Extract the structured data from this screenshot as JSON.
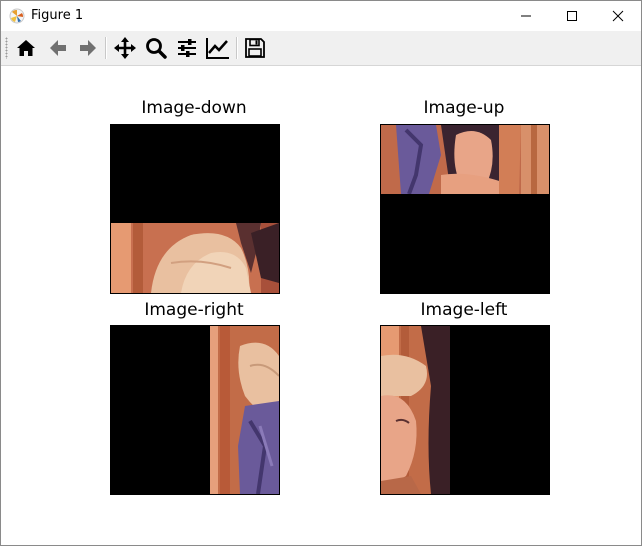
{
  "window": {
    "title": "Figure 1",
    "controls": [
      "minimize",
      "maximize",
      "close"
    ]
  },
  "toolbar": {
    "buttons": [
      {
        "icon": "home-icon",
        "tooltip": "Home"
      },
      {
        "icon": "back-arrow-icon",
        "tooltip": "Back"
      },
      {
        "icon": "forward-arrow-icon",
        "tooltip": "Forward"
      },
      {
        "icon": "pan-move-icon",
        "tooltip": "Pan"
      },
      {
        "icon": "zoom-magnifier-icon",
        "tooltip": "Zoom"
      },
      {
        "icon": "configure-subplots-icon",
        "tooltip": "Subplots"
      },
      {
        "icon": "edit-axis-icon",
        "tooltip": "Customize"
      },
      {
        "icon": "save-floppy-icon",
        "tooltip": "Save"
      }
    ]
  },
  "figure": {
    "subplots": [
      {
        "title": "Image-down",
        "shift": "down",
        "image_fraction_visible": 0.42
      },
      {
        "title": "Image-up",
        "shift": "up",
        "image_fraction_visible": 0.41
      },
      {
        "title": "Image-right",
        "shift": "right",
        "image_fraction_visible": 0.41
      },
      {
        "title": "Image-left",
        "shift": "left",
        "image_fraction_visible": 0.41
      }
    ]
  },
  "colors": {
    "background": "#000000",
    "skin": "#e7a080",
    "hat": "#e9c0a0",
    "feather": "#6a5a9a",
    "wall": "#c86a40"
  }
}
